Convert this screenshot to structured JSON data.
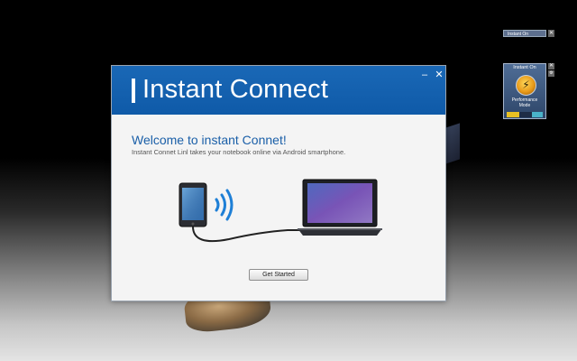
{
  "dialog": {
    "title": "Instant Connect",
    "minimize_label": "–",
    "close_label": "✕",
    "welcome": "Welcome to instant Connet!",
    "subtitle": "Instant Connet Linl takes your notebook online via Android smartphone.",
    "start_button": "Get Started"
  },
  "gadget_mini": {
    "title": "Instant On",
    "close_label": "✕"
  },
  "gadget": {
    "title": "Instant On",
    "caption_line1": "Performance",
    "caption_line2": "Mode",
    "close_label": "✕",
    "options_label": "⚙"
  },
  "colors": {
    "header_blue": "#1565b3",
    "welcome_blue": "#1a5fa8",
    "dialog_bg": "#f4f4f4"
  },
  "icons": {
    "phone": "smartphone-icon",
    "wifi": "wireless-signal-icon",
    "laptop": "laptop-icon",
    "power": "power-icon"
  }
}
